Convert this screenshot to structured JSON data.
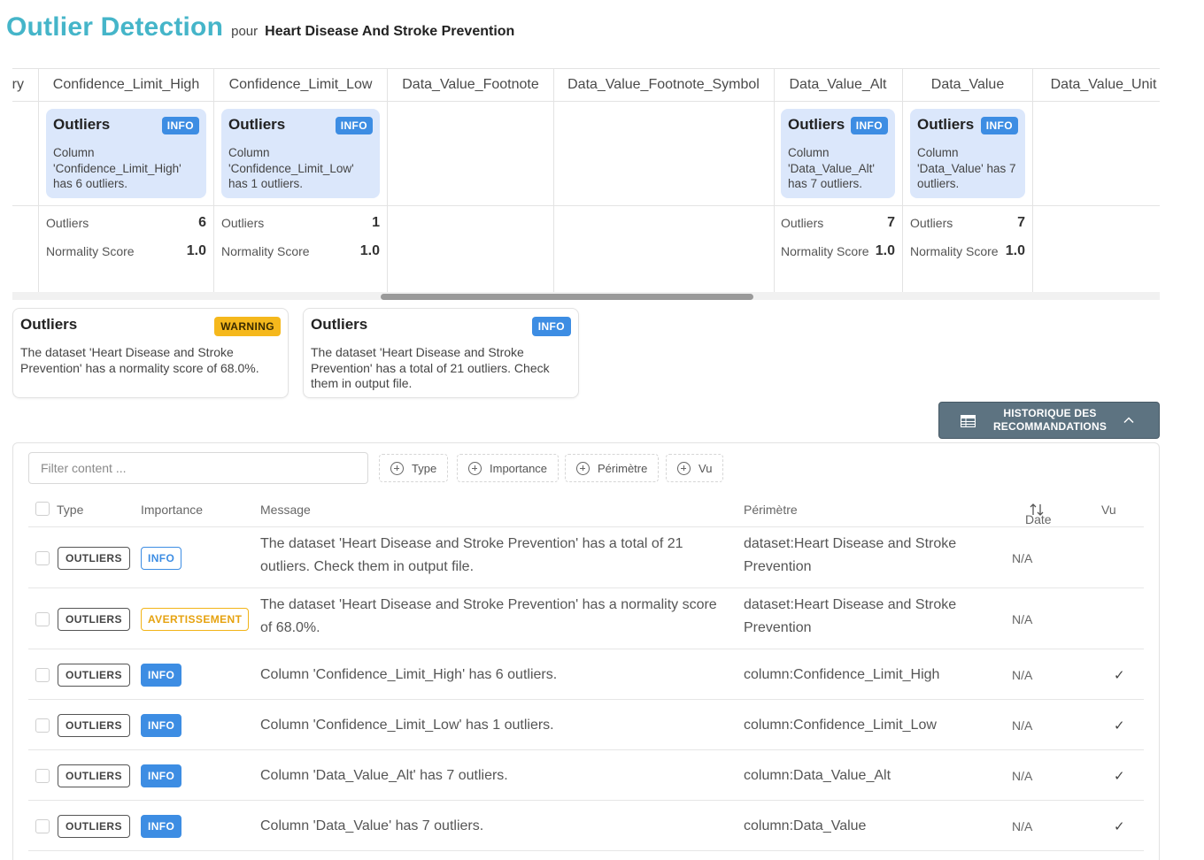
{
  "header": {
    "title": "Outlier Detection",
    "connector": "pour",
    "dataset_name": "Heart Disease And Stroke Prevention"
  },
  "column_grid": {
    "columns": [
      {
        "name": "ry",
        "card": null,
        "stats": null
      },
      {
        "name": "Confidence_Limit_High",
        "card": {
          "title": "Outliers",
          "badge": "INFO",
          "text": "Column 'Confidence_Limit_High' has 6 outliers."
        },
        "stats": {
          "outliers_label": "Outliers",
          "outliers_value": "6",
          "normality_label": "Normality Score",
          "normality_value": "1.0"
        }
      },
      {
        "name": "Confidence_Limit_Low",
        "card": {
          "title": "Outliers",
          "badge": "INFO",
          "text": "Column 'Confidence_Limit_Low' has 1 outliers."
        },
        "stats": {
          "outliers_label": "Outliers",
          "outliers_value": "1",
          "normality_label": "Normality Score",
          "normality_value": "1.0"
        }
      },
      {
        "name": "Data_Value_Footnote",
        "card": null,
        "stats": null
      },
      {
        "name": "Data_Value_Footnote_Symbol",
        "card": null,
        "stats": null
      },
      {
        "name": "Data_Value_Alt",
        "card": {
          "title": "Outliers",
          "badge": "INFO",
          "text": "Column 'Data_Value_Alt' has 7 outliers."
        },
        "stats": {
          "outliers_label": "Outliers",
          "outliers_value": "7",
          "normality_label": "Normality Score",
          "normality_value": "1.0"
        }
      },
      {
        "name": "Data_Value",
        "card": {
          "title": "Outliers",
          "badge": "INFO",
          "text": "Column 'Data_Value' has 7 outliers."
        },
        "stats": {
          "outliers_label": "Outliers",
          "outliers_value": "7",
          "normality_label": "Normality Score",
          "normality_value": "1.0"
        }
      },
      {
        "name": "Data_Value_Unit",
        "card": null,
        "stats": null
      }
    ]
  },
  "dataset_cards": [
    {
      "title": "Outliers",
      "badge": "WARNING",
      "badge_color": "#f5b81c",
      "text": "The dataset 'Heart Disease and Stroke Prevention' has a normality score of 68.0%."
    },
    {
      "title": "Outliers",
      "badge": "INFO",
      "badge_color": "#3d8de3",
      "text": "The dataset 'Heart Disease and Stroke Prevention' has a total of 21 outliers. Check them in output file."
    }
  ],
  "history_button": {
    "label": "HISTORIQUE DES RECOMMANDATIONS",
    "icon": "table-icon",
    "chevron": "chevron-up-icon"
  },
  "filters": {
    "placeholder": "Filter content ...",
    "buttons": [
      "Type",
      "Importance",
      "Périmètre",
      "Vu"
    ]
  },
  "table": {
    "headers": {
      "type": "Type",
      "importance": "Importance",
      "message": "Message",
      "perimetre": "Périmètre",
      "date": "Date",
      "vu": "Vu"
    },
    "rows": [
      {
        "type": "OUTLIERS",
        "importance": "INFO",
        "importance_style": "outline",
        "message": "The dataset 'Heart Disease and Stroke Prevention' has a total of 21 outliers. Check them in output file.",
        "perimetre": "dataset:Heart Disease and Stroke Prevention",
        "date": "N/A",
        "vu": ""
      },
      {
        "type": "OUTLIERS",
        "importance": "AVERTISSEMENT",
        "importance_style": "warning",
        "message": "The dataset 'Heart Disease and Stroke Prevention' has a normality score of 68.0%.",
        "perimetre": "dataset:Heart Disease and Stroke Prevention",
        "date": "N/A",
        "vu": ""
      },
      {
        "type": "OUTLIERS",
        "importance": "INFO",
        "importance_style": "solid",
        "message": "Column 'Confidence_Limit_High' has 6 outliers.",
        "perimetre": "column:Confidence_Limit_High",
        "date": "N/A",
        "vu": "✓"
      },
      {
        "type": "OUTLIERS",
        "importance": "INFO",
        "importance_style": "solid",
        "message": "Column 'Confidence_Limit_Low' has 1 outliers.",
        "perimetre": "column:Confidence_Limit_Low",
        "date": "N/A",
        "vu": "✓"
      },
      {
        "type": "OUTLIERS",
        "importance": "INFO",
        "importance_style": "solid",
        "message": "Column 'Data_Value_Alt' has 7 outliers.",
        "perimetre": "column:Data_Value_Alt",
        "date": "N/A",
        "vu": "✓"
      },
      {
        "type": "OUTLIERS",
        "importance": "INFO",
        "importance_style": "solid",
        "message": "Column 'Data_Value' has 7 outliers.",
        "perimetre": "column:Data_Value",
        "date": "N/A",
        "vu": "✓"
      }
    ]
  }
}
